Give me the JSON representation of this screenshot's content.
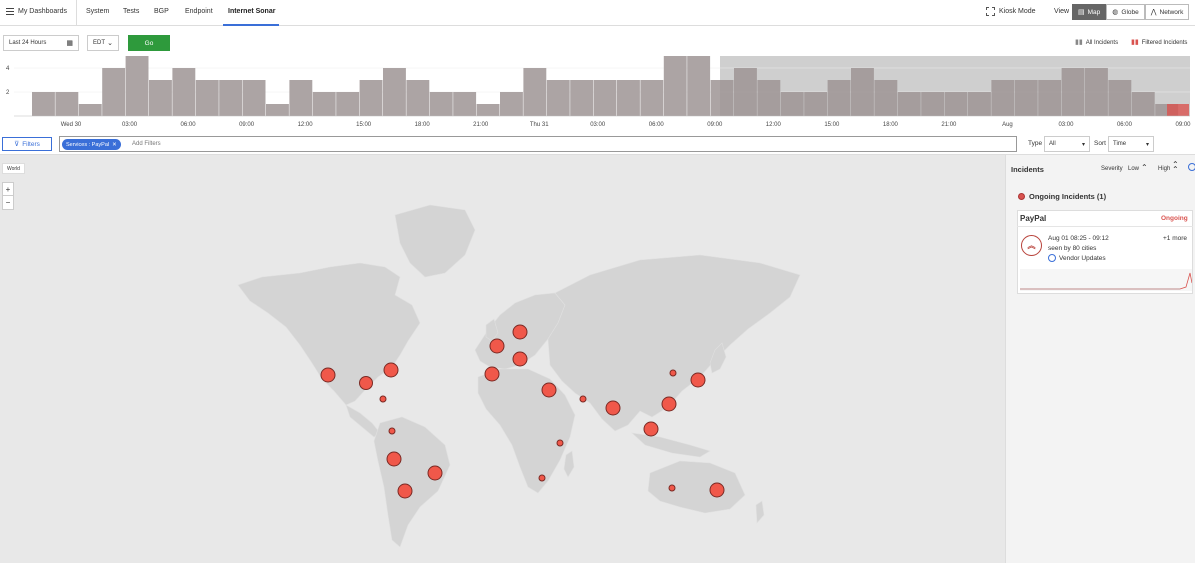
{
  "nav": {
    "dashboards": "My Dashboards",
    "tabs": [
      "System",
      "Tests",
      "BGP",
      "Endpoint",
      "Internet Sonar"
    ],
    "kiosk": "Kiosk Mode",
    "view_label": "View",
    "views": [
      "Map",
      "Globe",
      "Network"
    ]
  },
  "controls": {
    "range": "Last 24 Hours",
    "tz": "EDT",
    "go": "Go",
    "legend_all": "All Incidents",
    "legend_filtered": "Filtered Incidents"
  },
  "chart_data": {
    "type": "bar",
    "y_ticks": [
      2,
      4
    ],
    "ylim": [
      0,
      5
    ],
    "x_tick_labels": [
      "Wed 30",
      "03:00",
      "06:00",
      "09:00",
      "12:00",
      "15:00",
      "18:00",
      "21:00",
      "Thu 31",
      "03:00",
      "06:00",
      "09:00",
      "12:00",
      "15:00",
      "18:00",
      "21:00",
      "Aug",
      "03:00",
      "06:00",
      "09:00"
    ],
    "values": [
      2,
      2,
      1,
      4,
      5,
      3,
      4,
      3,
      3,
      3,
      1,
      3,
      2,
      2,
      3,
      4,
      3,
      2,
      2,
      1,
      2,
      4,
      3,
      3,
      3,
      3,
      3,
      5,
      5,
      3,
      4,
      3,
      2,
      2,
      3,
      4,
      3,
      2,
      2,
      2,
      2,
      3,
      3,
      3,
      4,
      4,
      3,
      2,
      1,
      1
    ],
    "colors": {
      "bar": "#9e9494",
      "selection": "#ececec",
      "filtered": "#d9534f"
    }
  },
  "filters": {
    "button": "Filters",
    "chip": "Services : PayPal",
    "placeholder": "Add Filters",
    "type_label": "Type",
    "type_value": "All",
    "sort_label": "Sort",
    "sort_value": "Time"
  },
  "map": {
    "world_tag": "World",
    "zoom_in": "+",
    "zoom_out": "−"
  },
  "incidents": {
    "title": "Incidents",
    "severity_label": "Severity",
    "low": "Low",
    "high": "High",
    "ongoing_header": "Ongoing Incidents (1)",
    "card": {
      "service": "PayPal",
      "status": "Ongoing",
      "time": "Aug 01 08:25 - 09:12",
      "seen": "seen by 80 cities",
      "category": "Vendor Updates",
      "more": "+1 more"
    }
  }
}
